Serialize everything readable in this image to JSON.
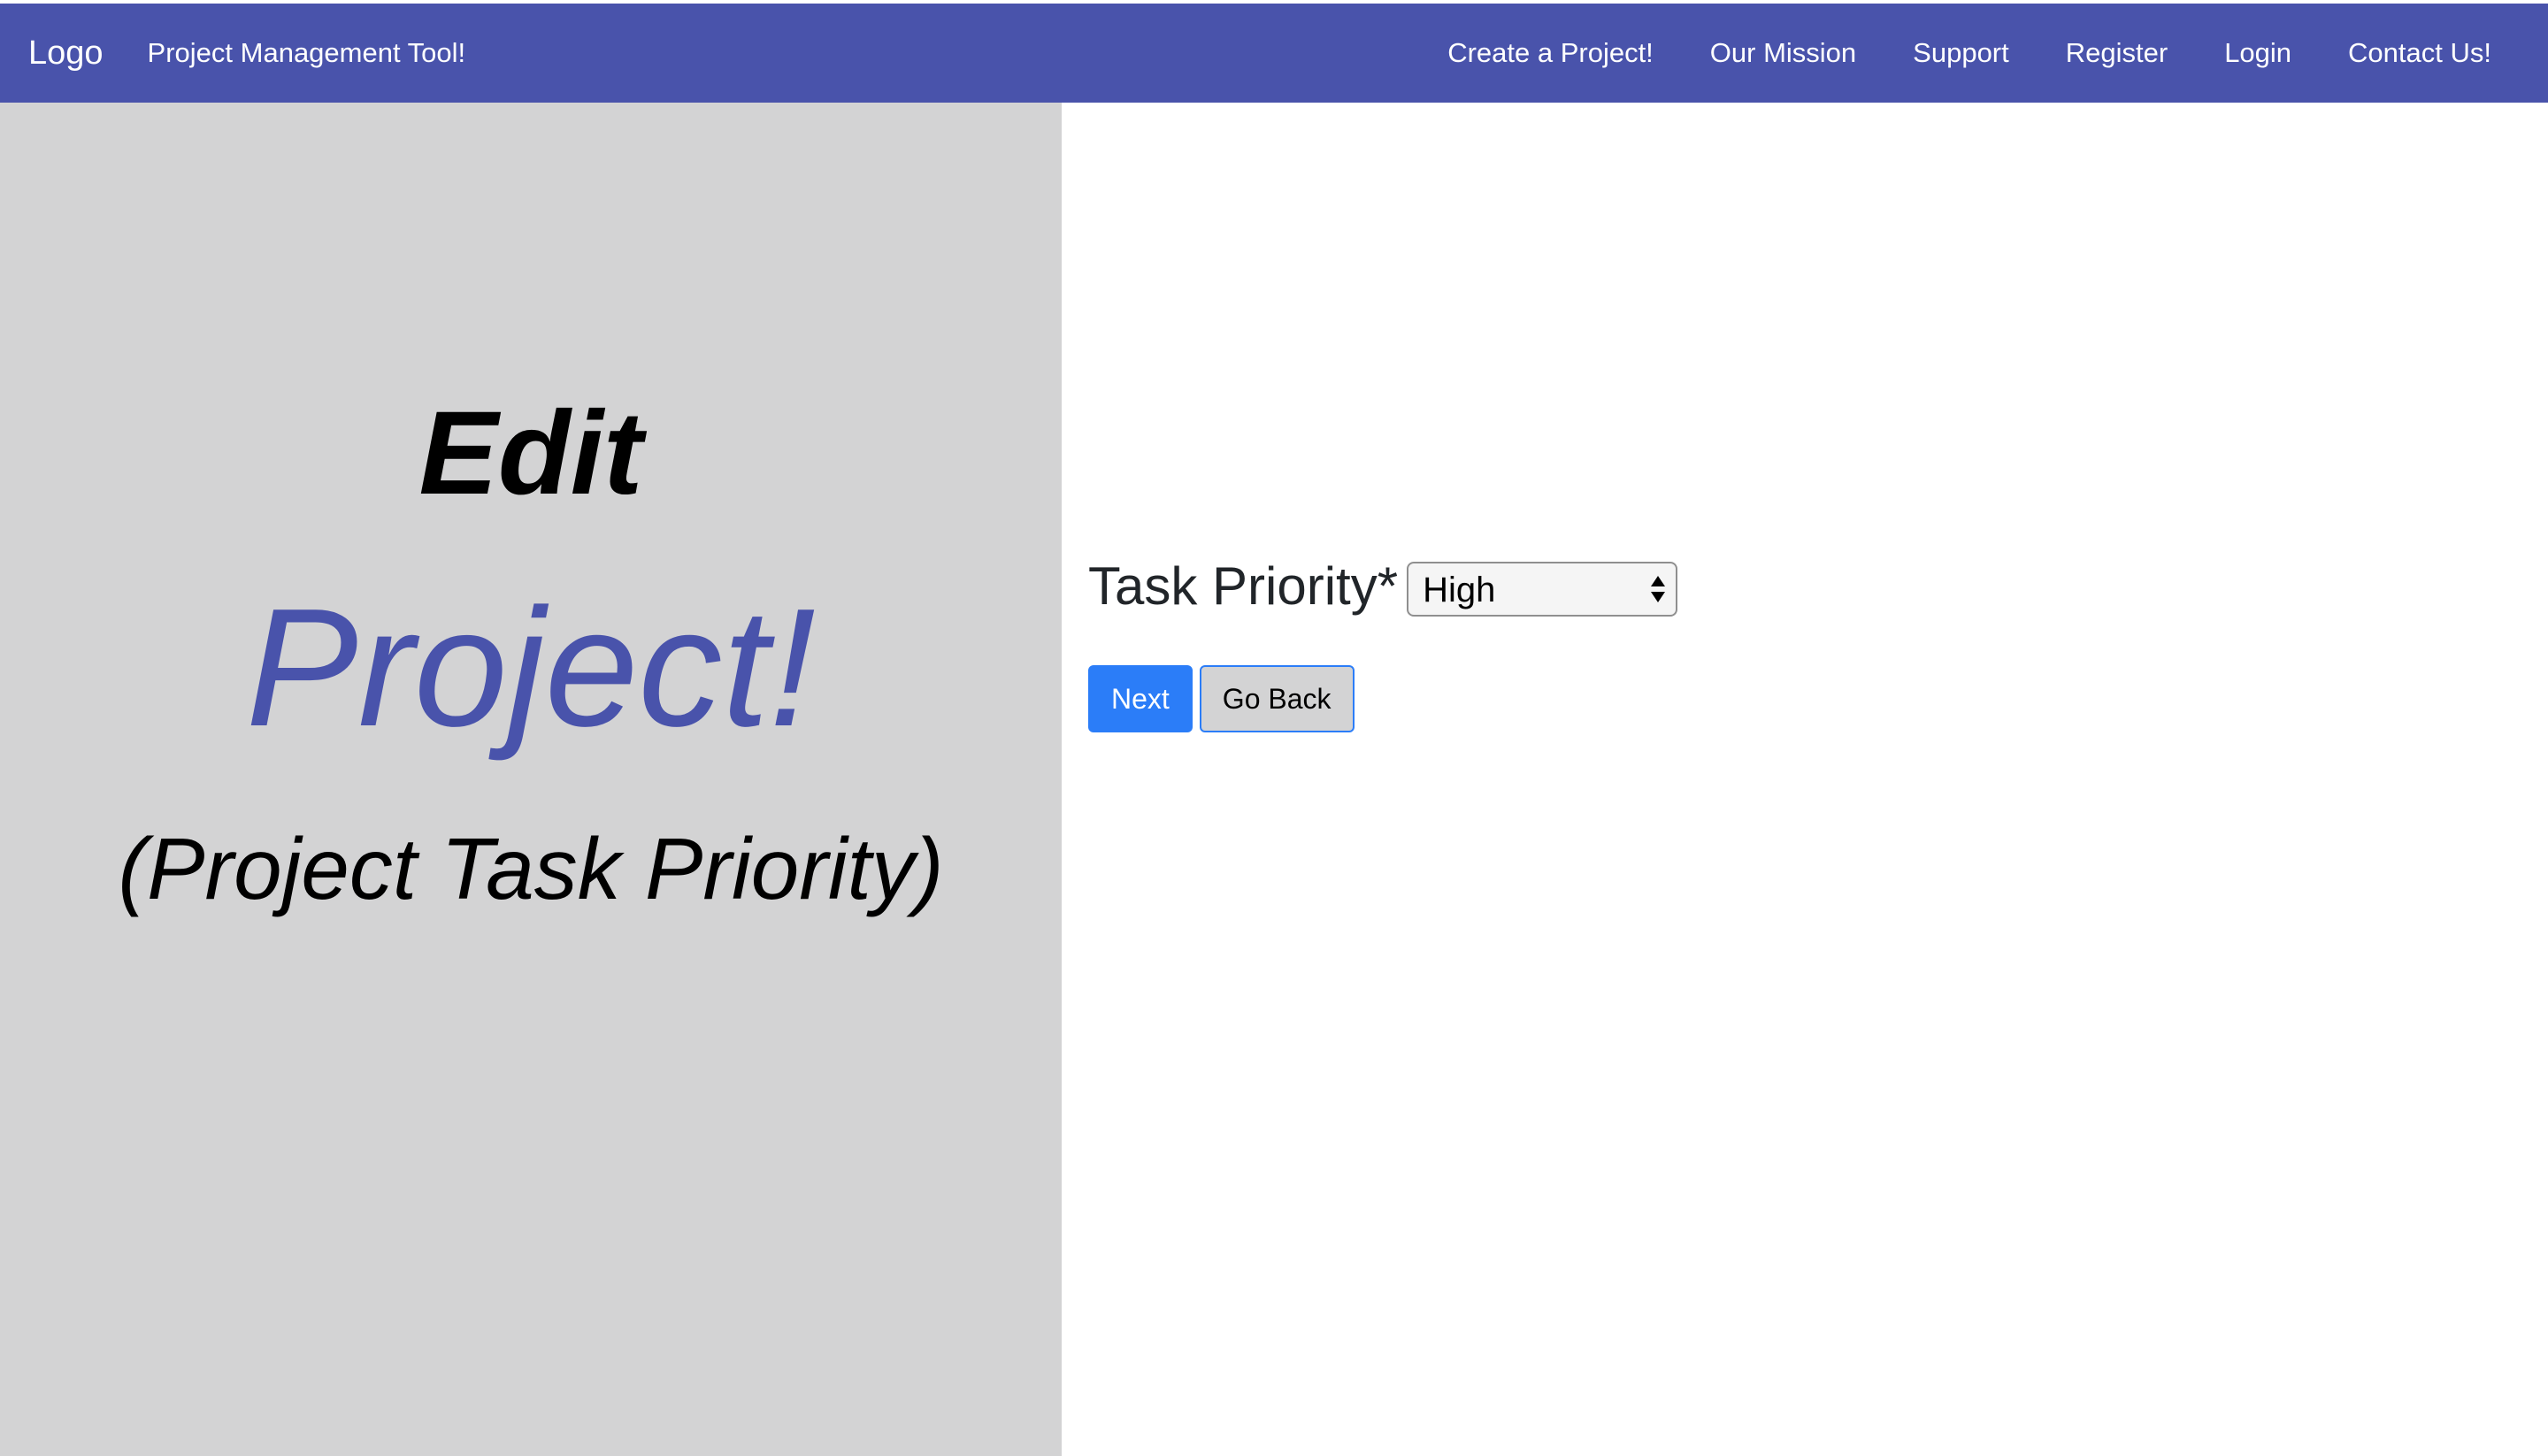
{
  "navbar": {
    "logo": "Logo",
    "brand": "Project Management Tool!",
    "links": [
      "Create a Project!",
      "Our Mission",
      "Support",
      "Register",
      "Login",
      "Contact Us!"
    ]
  },
  "hero": {
    "line1": "Edit",
    "line2": "Project!",
    "line3": "(Project Task Priority)"
  },
  "form": {
    "priority_label": "Task Priority*",
    "priority_value": "High",
    "next_label": "Next",
    "back_label": "Go Back"
  },
  "colors": {
    "navbar": "#4953ab",
    "accent": "#4953ab",
    "left_panel": "#d3d3d4",
    "primary_button": "#2b7df8"
  }
}
